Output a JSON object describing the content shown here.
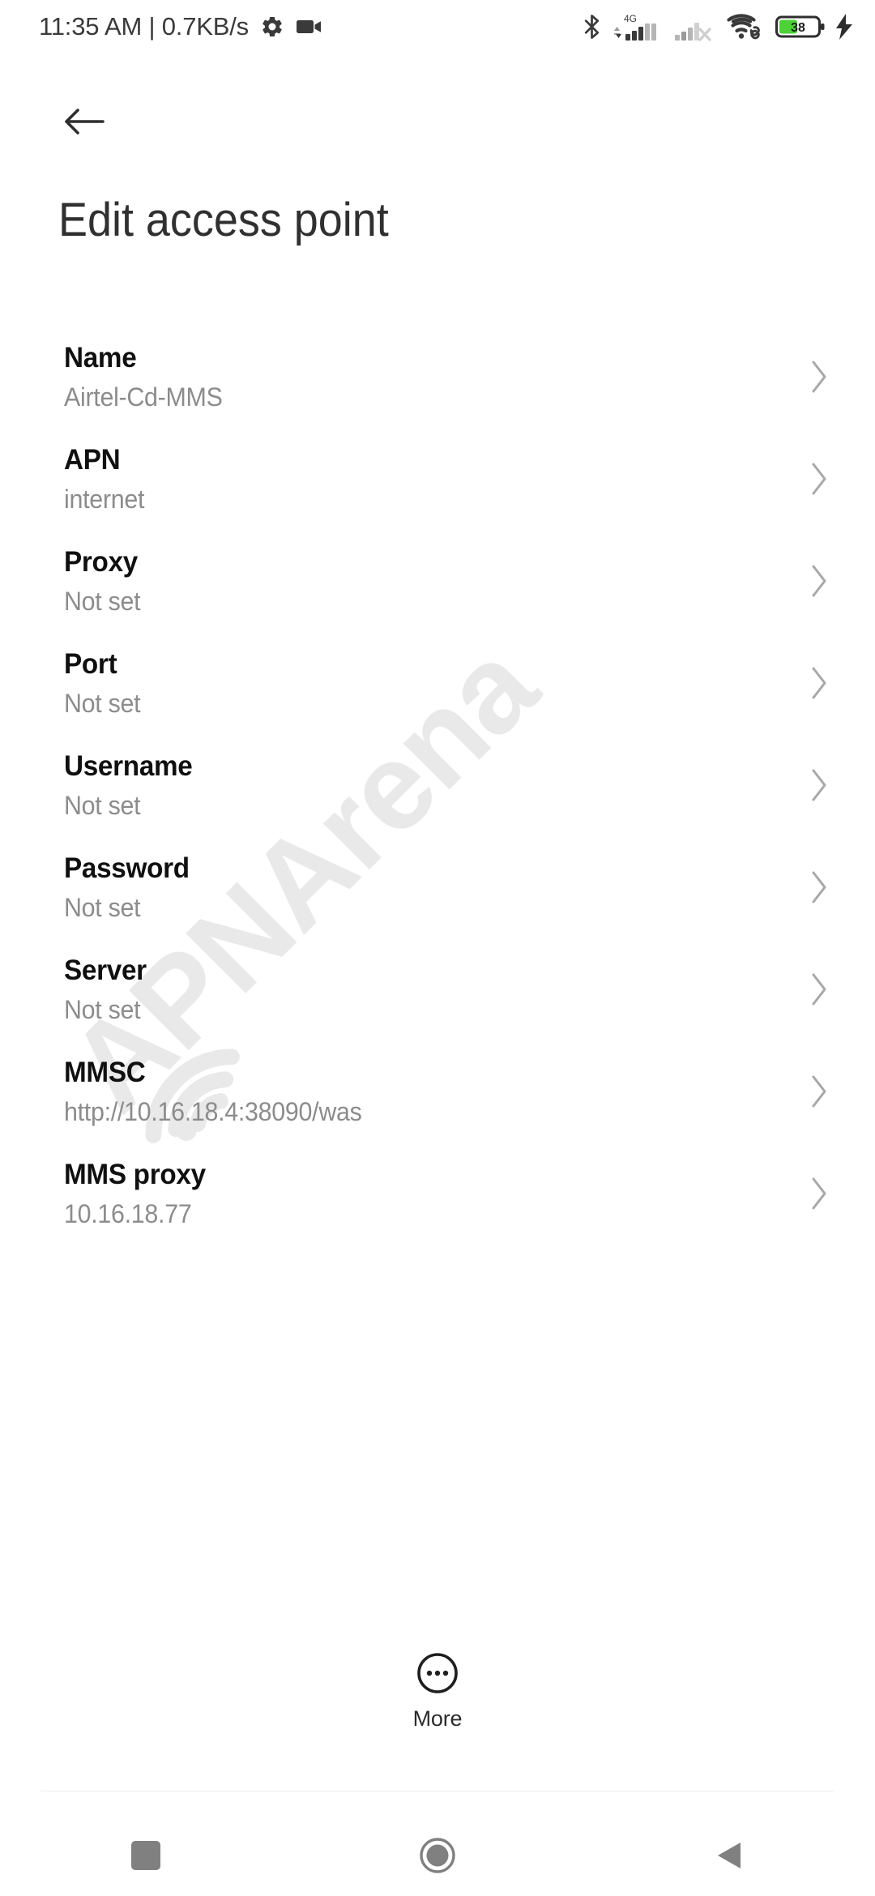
{
  "statusbar": {
    "clock": "11:35 AM | 0.7KB/s",
    "icons_left": [
      "gear-icon",
      "video-camera-icon"
    ],
    "icons_right": [
      "bluetooth-icon",
      "signal-4g-icon",
      "signal-sim2-no-service-icon",
      "wifi-icon",
      "battery-icon",
      "charging-bolt-icon"
    ],
    "network_type": "4G",
    "battery_percent": "38",
    "battery_color": "#4cd137",
    "charging": true
  },
  "header": {
    "back_icon": "arrow-left-icon",
    "title": "Edit access point"
  },
  "watermark": {
    "text": "APNArena",
    "color": "#e9e9e9",
    "logo": "wifi-arc-icon"
  },
  "list": {
    "chevron_icon": "chevron-right-icon",
    "rows": [
      {
        "label": "Name",
        "value": "Airtel-Cd-MMS"
      },
      {
        "label": "APN",
        "value": "internet"
      },
      {
        "label": "Proxy",
        "value": "Not set"
      },
      {
        "label": "Port",
        "value": "Not set"
      },
      {
        "label": "Username",
        "value": "Not set"
      },
      {
        "label": "Password",
        "value": "Not set"
      },
      {
        "label": "Server",
        "value": "Not set"
      },
      {
        "label": "MMSC",
        "value": "http://10.16.18.4:38090/was"
      },
      {
        "label": "MMS proxy",
        "value": "10.16.18.77"
      }
    ]
  },
  "more": {
    "label": "More",
    "icon": "overflow-dots-circle-icon"
  },
  "navbar": {
    "recents": "recents-square-icon",
    "home": "home-circle-icon",
    "back": "back-triangle-icon",
    "color": "#808080"
  }
}
